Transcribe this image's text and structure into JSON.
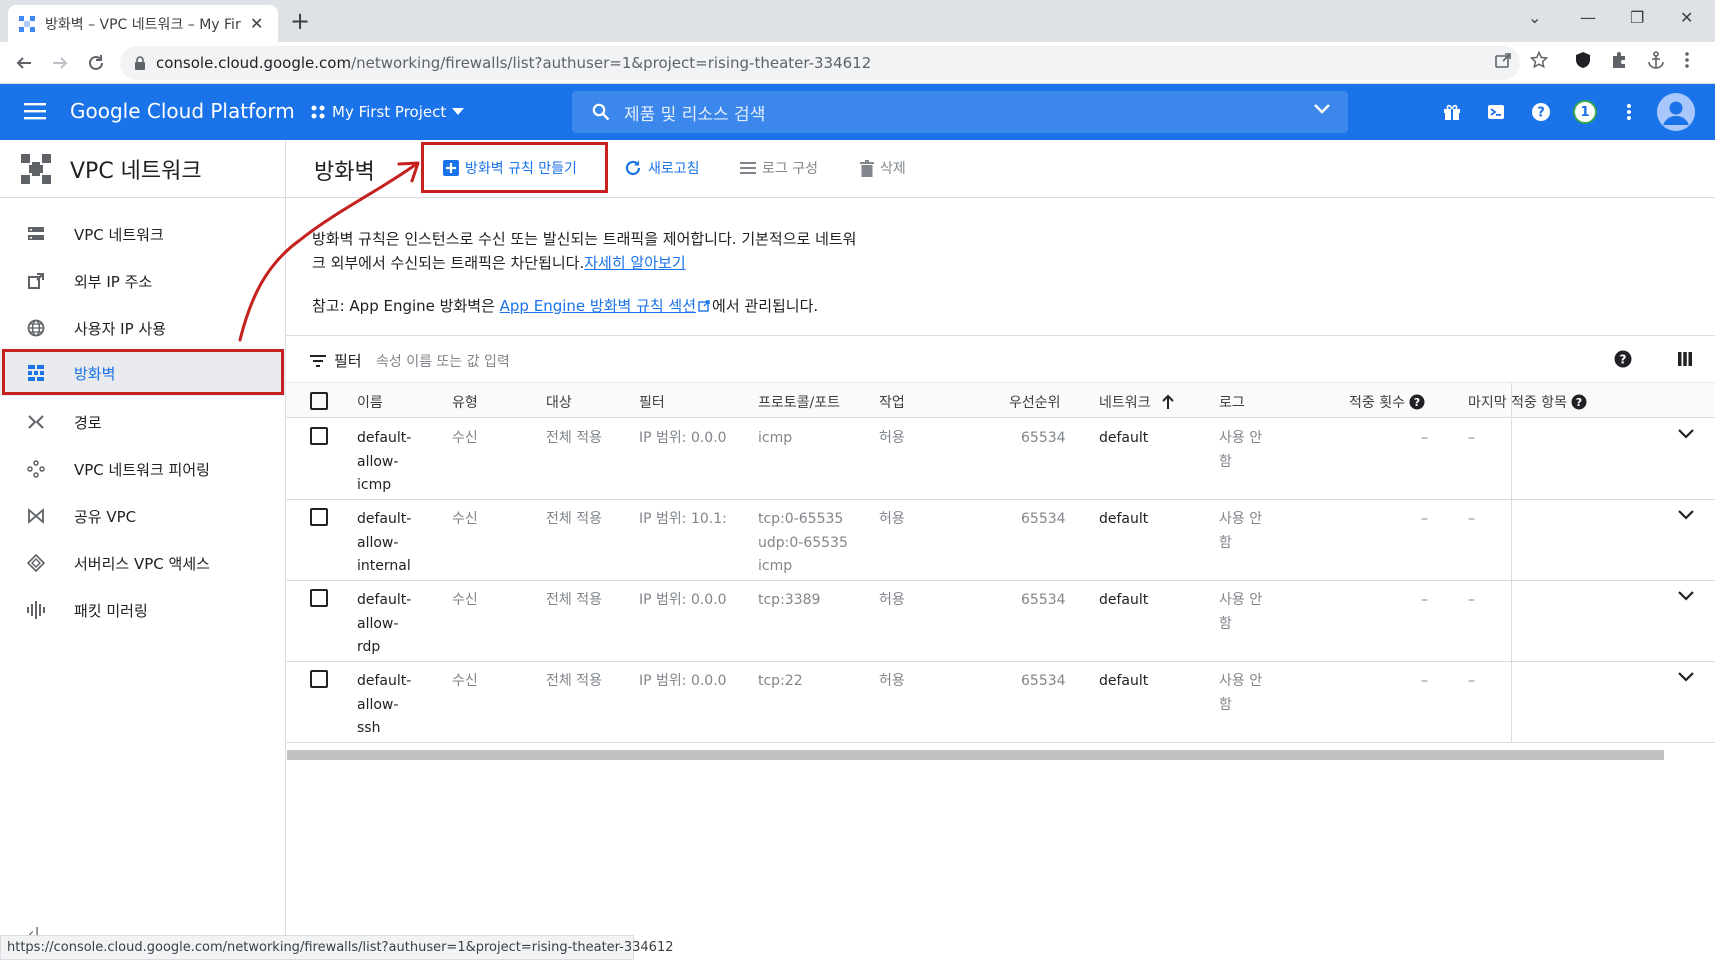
{
  "browser": {
    "tab_title": "방화벽 – VPC 네트워크 – My First Project",
    "url_host": "console.cloud.google.com",
    "url_rest": "/networking/firewalls/list?authuser=1&project=rising-theater-334612",
    "status_url": "https://console.cloud.google.com/networking/firewalls/list?authuser=1&project=rising-theater-334612"
  },
  "header": {
    "app_title": "Google Cloud Platform",
    "project": "My First Project",
    "search_placeholder": "제품 및 리소스 검색",
    "notification_count": "1"
  },
  "sidebar": {
    "title": "VPC 네트워크",
    "items": [
      {
        "label": "VPC 네트워크",
        "icon": "vpc-network-icon"
      },
      {
        "label": "외부 IP 주소",
        "icon": "external-ip-icon"
      },
      {
        "label": "사용자 IP 사용",
        "icon": "globe-icon"
      },
      {
        "label": "방화벽",
        "icon": "firewall-icon"
      },
      {
        "label": "경로",
        "icon": "route-icon"
      },
      {
        "label": "VPC 네트워크 피어링",
        "icon": "peering-icon"
      },
      {
        "label": "공유 VPC",
        "icon": "shared-vpc-icon"
      },
      {
        "label": "서버리스 VPC 액세스",
        "icon": "serverless-icon"
      },
      {
        "label": "패킷 미러링",
        "icon": "packet-mirroring-icon"
      }
    ],
    "active_index": 3
  },
  "page": {
    "title": "방화벽",
    "toolbar": {
      "create": "방화벽 규칙 만들기",
      "refresh": "새로고침",
      "logs": "로그 구성",
      "delete": "삭제"
    },
    "desc_line1": "방화벽 규칙은 인스턴스로 수신 또는 발신되는 트래픽을 제어합니다. 기본적으로 네트워",
    "desc_line2": "크 외부에서 수신되는 트래픽은 차단됩니다.",
    "learn_more": "자세히 알아보기",
    "note_prefix": "참고: App Engine 방화벽은 ",
    "note_link": "App Engine 방화벽 규칙 섹션",
    "note_suffix": "에서 관리됩니다.",
    "filter_label": "필터",
    "filter_placeholder": "속성 이름 또는 값 입력"
  },
  "table": {
    "columns": {
      "name": "이름",
      "type": "유형",
      "targets": "대상",
      "filters": "필터",
      "protocols": "프로토콜/포트",
      "action": "작업",
      "priority": "우선순위",
      "network": "네트워크",
      "logs": "로그",
      "hit_count": "적중 횟수",
      "last_hit": "마지막 적중 항목"
    },
    "rows": [
      {
        "name": "default-\nallow-\nicmp",
        "type": "수신",
        "targets": "전체 적용",
        "filters": "IP 범위: 0.0.0",
        "protocols": "icmp",
        "action": "허용",
        "priority": "65534",
        "network": "default",
        "logs": "사용 안\n함",
        "hit_count": "–",
        "last_hit": "–"
      },
      {
        "name": "default-\nallow-\ninternal",
        "type": "수신",
        "targets": "전체 적용",
        "filters": "IP 범위: 10.1:",
        "protocols": "tcp:0-65535\nudp:0-65535\nicmp",
        "action": "허용",
        "priority": "65534",
        "network": "default",
        "logs": "사용 안\n함",
        "hit_count": "–",
        "last_hit": "–"
      },
      {
        "name": "default-\nallow-\nrdp",
        "type": "수신",
        "targets": "전체 적용",
        "filters": "IP 범위: 0.0.0",
        "protocols": "tcp:3389",
        "action": "허용",
        "priority": "65534",
        "network": "default",
        "logs": "사용 안\n함",
        "hit_count": "–",
        "last_hit": "–"
      },
      {
        "name": "default-\nallow-\nssh",
        "type": "수신",
        "targets": "전체 적용",
        "filters": "IP 범위: 0.0.0",
        "protocols": "tcp:22",
        "action": "허용",
        "priority": "65534",
        "network": "default",
        "logs": "사용 안\n함",
        "hit_count": "–",
        "last_hit": "–"
      }
    ]
  },
  "colors": {
    "brand": "#1a73e8",
    "annotation": "#c5221f"
  }
}
